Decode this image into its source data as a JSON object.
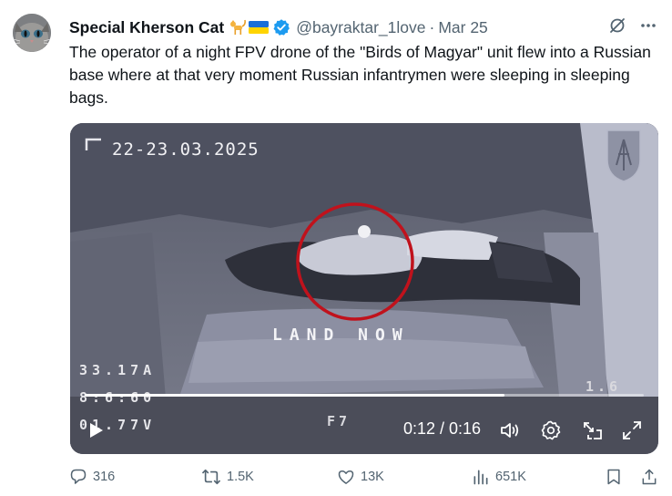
{
  "author": {
    "display_name": "Special Kherson Cat",
    "emoji": [
      "cat-emoji",
      "ukraine-flag-emoji"
    ],
    "handle": "@bayraktar_1love",
    "separator": "·",
    "date": "Mar 25"
  },
  "tweet": {
    "text": "The operator of a night FPV drone of the \"Birds of Magyar\" unit flew into a Russian base where at that very moment Russian infantrymen were sleeping in sleeping bags."
  },
  "video": {
    "overlay_date": "22-23.03.2025",
    "overlay_center": "LAND NOW",
    "overlay_left_1": "33.17A",
    "overlay_left_2": "8:6:60",
    "overlay_left_3": "01.77V",
    "overlay_mid": "F7",
    "overlay_right": "1.6",
    "progress": 0.75,
    "time_display": "0:12 / 0:16",
    "highlight_color": "#c0121c"
  },
  "actions": {
    "replies": "316",
    "reposts": "1.5K",
    "likes": "13K",
    "views": "651K"
  },
  "colors": {
    "text": "#0f1419",
    "muted": "#536471",
    "verified": "#1d9bf0",
    "grok": "#536471"
  },
  "icons": [
    "grok-icon",
    "more-icon",
    "play-icon",
    "volume-icon",
    "settings-icon",
    "pip-icon",
    "fullscreen-icon",
    "reply-icon",
    "repost-icon",
    "like-icon",
    "views-icon",
    "bookmark-icon",
    "share-icon"
  ]
}
